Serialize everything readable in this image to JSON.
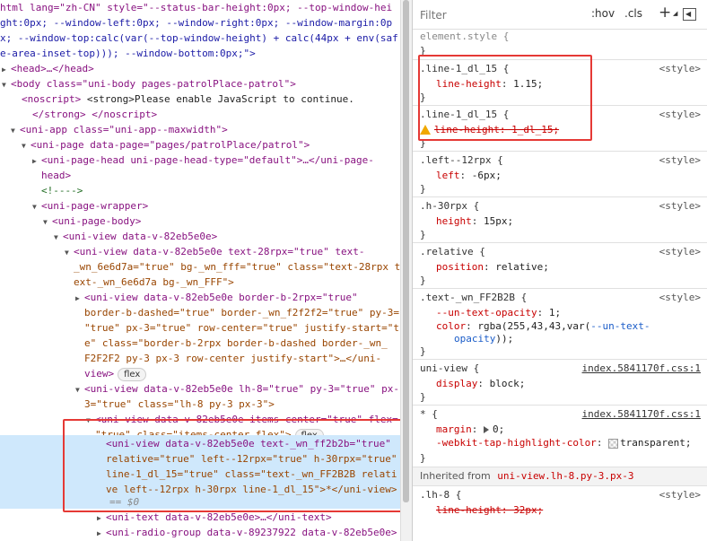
{
  "dom_lines": [
    {
      "indent": 0,
      "arrow": "",
      "html": "html lang=\"zh-CN\" style=\"--status-bar-height:0px; --top-window-hei",
      "raw": true
    },
    {
      "indent": 0,
      "arrow": "",
      "html": "ght:0px; --window-left:0px; --window-right:0px; --window-margin:0p",
      "raw": true
    },
    {
      "indent": 0,
      "arrow": "",
      "html": "x; --window-top:calc(var(--top-window-height) + calc(44px + env(saf",
      "raw": true
    },
    {
      "indent": 0,
      "arrow": "",
      "html": "e-area-inset-top))); --window-bottom:0px;\">",
      "raw": true
    }
  ],
  "tree": {
    "head": "<head>…</head>",
    "body_open": "<body class=\"uni-body pages-patrolPlace-patrol\">",
    "noscript_open": "<noscript>",
    "noscript_text": "<strong>Please enable JavaScript to continue.",
    "noscript_close": "</strong> </noscript>",
    "uni_app": "<uni-app class=\"uni-app--maxwidth\">",
    "uni_page": "<uni-page data-page=\"pages/patrolPlace/patrol\">",
    "page_head_1": "<uni-page-head uni-page-head-type=\"default\">…</uni-page-",
    "page_head_2": "head>",
    "comment": "<!---->",
    "page_wrapper": "<uni-page-wrapper>",
    "page_body": "<uni-page-body>",
    "view1": "<uni-view data-v-82eb5e0e>",
    "view2_1": "<uni-view data-v-82eb5e0e text-28rpx=\"true\" text-",
    "view2_2": "_wn_6e6d7a=\"true\" bg-_wn_fff=\"true\" class=\"text-28rpx t",
    "view2_3": "ext-_wn_6e6d7a bg-_wn_FFF\">",
    "view3_1": "<uni-view data-v-82eb5e0e border-b-2rpx=\"true\"",
    "view3_2": "border-b-dashed=\"true\" border-_wn_f2f2f2=\"true\" py-3=",
    "view3_3": "\"true\" px-3=\"true\" row-center=\"true\" justify-start=\"tru",
    "view3_4": "e\" class=\"border-b-2rpx border-b-dashed border-_wn_",
    "view3_5": "F2F2F2 py-3 px-3 row-center justify-start\">…</uni-",
    "view3_6": "view>",
    "view4_1": "<uni-view data-v-82eb5e0e lh-8=\"true\" py-3=\"true\" px-",
    "view4_2": "3=\"true\" class=\"lh-8 py-3 px-3\">",
    "view5_1": "<uni-view data-v-82eb5e0e items-center=\"true\" flex=",
    "view5_2": "\"true\" class=\"items-center flex\">",
    "sel_1": "<uni-view data-v-82eb5e0e text-_wn_ff2b2b=\"true\"",
    "sel_2": "relative=\"true\" left--12rpx=\"true\" h-30rpx=\"true\"",
    "sel_3": "line-1_dl_15=\"true\" class=\"text-_wn_FF2B2B relati",
    "sel_4": "ve left--12rpx h-30rpx line-1_dl_15\">*</uni-view>",
    "sel_eq": "== $0",
    "uni_text": "<uni-text data-v-82eb5e0e>…</uni-text>",
    "radio_group": "<uni-radio-group data-v-89237922 data-v-82eb5e0e>",
    "flex_badge": "flex"
  },
  "styles": {
    "filter_placeholder": "Filter",
    "hov": ":hov",
    "cls": ".cls",
    "plus": "+",
    "element_style": "element.style {",
    "close_brace": "}",
    "style_src": "<style>",
    "rule1_sel": ".line-1_dl_15 {",
    "rule1_prop": "line-height",
    "rule1_val": "1.15;",
    "rule2_sel": ".line-1_dl_15 {",
    "rule2_decl": "line-height: 1_dl_15;",
    "rule3_sel": ".left--12rpx {",
    "rule3_prop": "left",
    "rule3_val": "-6px;",
    "rule4_sel": ".h-30rpx {",
    "rule4_prop": "height",
    "rule4_val": "15px;",
    "rule5_sel": ".relative {",
    "rule5_prop": "position",
    "rule5_val": "relative;",
    "rule6_sel": ".text-_wn_FF2B2B {",
    "rule6_prop1": "--un-text-opacity",
    "rule6_val1": "1;",
    "rule6_prop2": "color",
    "rule6_val2a": "rgba(255,43,43,var(",
    "rule6_var": "--un-text-",
    "rule6_val2b": "opacity",
    "rule6_val2c": "));",
    "rule7_sel": "uni-view {",
    "rule7_src": "index.5841170f.css:1",
    "rule7_prop": "display",
    "rule7_val": "block;",
    "rule8_sel": "* {",
    "rule8_src": "index.5841170f.css:1",
    "rule8_prop1": "margin",
    "rule8_val1": "0;",
    "rule8_prop2": "-webkit-tap-highlight-color",
    "rule8_val2": "transparent;",
    "inherited_label": "Inherited from",
    "inherited_from": "uni-view.lh-8.py-3.px-3",
    "rule9_sel": ".lh-8 {",
    "rule9_decl": "line-height: 32px;"
  },
  "colors": {
    "highlight_box": "#e53935",
    "selection": "#cfe8fc"
  }
}
